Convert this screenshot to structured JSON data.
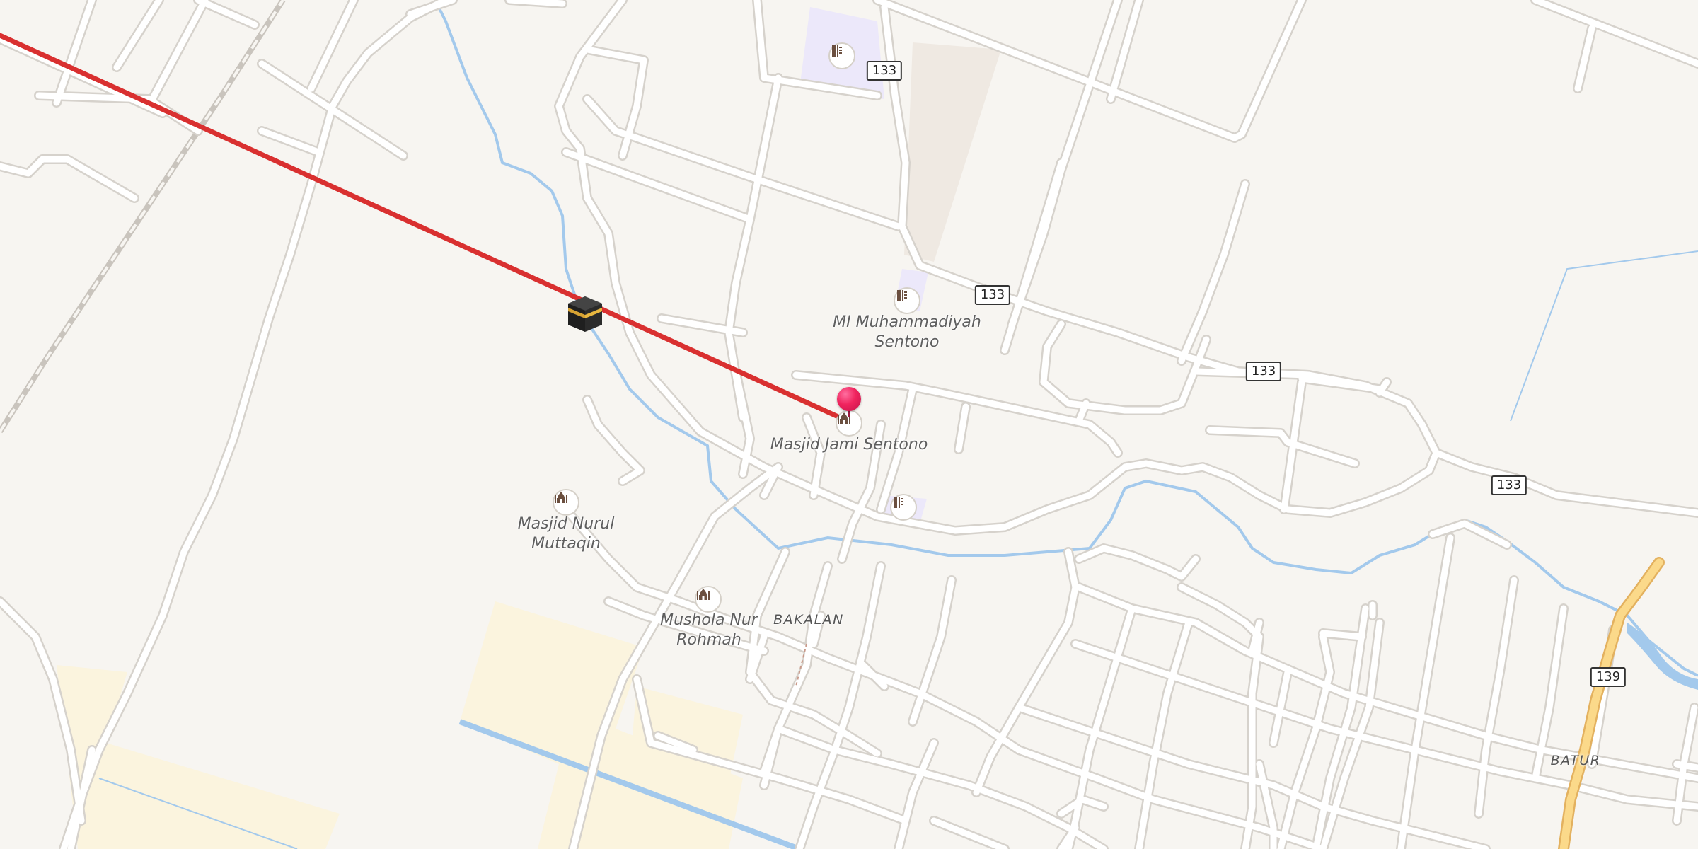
{
  "map": {
    "colors": {
      "background": "#f7f5f1",
      "road": "#ffffff",
      "water": "#a3c9ec",
      "qibla_line": "#d93030",
      "primary_road": "#fbd98a",
      "farmland": "#fbf4de",
      "school_area": "#ece8fa",
      "pin": "#f0245e"
    },
    "places": [
      {
        "name": "MI Muhammadiyah\nSentono",
        "type": "school"
      },
      {
        "name": "Masjid Jami Sentono",
        "type": "mosque"
      },
      {
        "name": "Masjid Nurul\nMuttaqin",
        "type": "mosque"
      },
      {
        "name": "Mushola Nur\nRohmah",
        "type": "mosque"
      }
    ],
    "areas": [
      "BAKALAN",
      "BATUR"
    ],
    "route_shields": [
      "133",
      "133",
      "133",
      "133",
      "139"
    ],
    "icons": {
      "qibla": "kaaba-icon",
      "school": "school-icon",
      "mosque": "mosque-icon",
      "location": "location-pin-icon"
    }
  }
}
